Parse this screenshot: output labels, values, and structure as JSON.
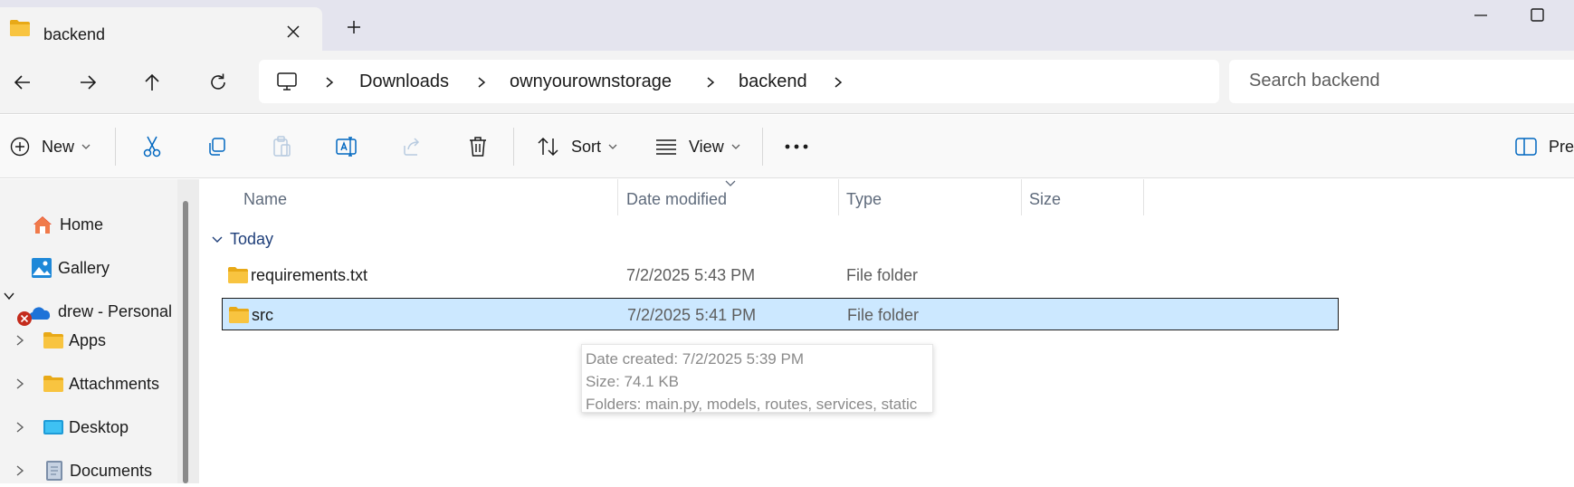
{
  "window": {
    "tab_title": "backend",
    "close_tab_symbol": "✕",
    "new_tab_symbol": "+"
  },
  "address": {
    "breadcrumb": [
      "Downloads",
      "ownyourownstorage",
      "backend"
    ],
    "search_placeholder": "Search backend"
  },
  "toolbar": {
    "new_label": "New",
    "sort_label": "Sort",
    "view_label": "View",
    "preview_label": "Prev"
  },
  "sidebar": {
    "items": [
      {
        "label": "Home",
        "icon": "home-icon"
      },
      {
        "label": "Gallery",
        "icon": "gallery-icon"
      },
      {
        "label": "drew - Personal",
        "icon": "onedrive-cloud-icon",
        "status": "sync-error-icon",
        "expanded": true
      },
      {
        "label": "Apps",
        "icon": "folder-icon"
      },
      {
        "label": "Attachments",
        "icon": "folder-icon"
      },
      {
        "label": "Desktop",
        "icon": "desktop-folder-icon"
      },
      {
        "label": "Documents",
        "icon": "documents-folder-icon"
      }
    ]
  },
  "file_list": {
    "columns": [
      "Name",
      "Date modified",
      "Type",
      "Size"
    ],
    "sorted_by": "Date modified",
    "group_label": "Today",
    "rows": [
      {
        "name": "requirements.txt",
        "date": "7/2/2025 5:43 PM",
        "type": "File folder",
        "selected": false
      },
      {
        "name": "src",
        "date": "7/2/2025 5:41 PM",
        "type": "File folder",
        "selected": true
      }
    ]
  },
  "tooltip": {
    "line1": "Date created: 7/2/2025 5:39 PM",
    "line2": "Size: 74.1 KB",
    "line3": "Folders: main.py, models, routes, services, static"
  },
  "colors": {
    "accent": "#0067c0",
    "selection": "#cce8ff",
    "folder": "#f8c440",
    "error": "#c42b1c",
    "onedrive": "#0f6cbd"
  }
}
